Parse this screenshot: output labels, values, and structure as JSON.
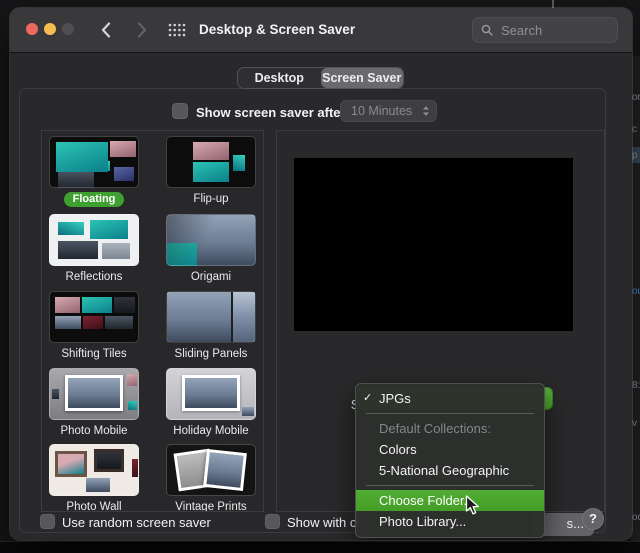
{
  "window": {
    "title": "Desktop & Screen Saver"
  },
  "titlebar": {
    "traffic_lights": [
      "close",
      "minimize",
      "zoom-disabled"
    ],
    "search_placeholder": "Search"
  },
  "tabs": [
    {
      "label": "Desktop",
      "selected": false
    },
    {
      "label": "Screen Saver",
      "selected": true
    }
  ],
  "settings": {
    "show_after_label": "Show screen saver after",
    "show_after_checked": false,
    "delay_value": "10 Minutes",
    "delay_enabled": false
  },
  "savers": {
    "items": [
      {
        "name": "Floating",
        "art": "floating",
        "selected": true
      },
      {
        "name": "Flip-up",
        "art": "flipup",
        "selected": false
      },
      {
        "name": "Reflections",
        "art": "reflections",
        "selected": false
      },
      {
        "name": "Origami",
        "art": "origami",
        "selected": false
      },
      {
        "name": "Shifting Tiles",
        "art": "shifting-tiles",
        "selected": false
      },
      {
        "name": "Sliding Panels",
        "art": "sliding-panels",
        "selected": false
      },
      {
        "name": "Photo Mobile",
        "art": "photo-mobile",
        "selected": false
      },
      {
        "name": "Holiday Mobile",
        "art": "holiday-mobile",
        "selected": false
      },
      {
        "name": "Photo Wall",
        "art": "photo-wall",
        "selected": false
      },
      {
        "name": "Vintage Prints",
        "art": "vintage-prints",
        "selected": false
      }
    ]
  },
  "source": {
    "label": "Source"
  },
  "source_menu": {
    "items": [
      {
        "type": "item",
        "label": "JPGs",
        "checked": true
      },
      {
        "type": "separator"
      },
      {
        "type": "header",
        "label": "Default Collections:"
      },
      {
        "type": "item",
        "label": "Colors"
      },
      {
        "type": "item",
        "label": "5-National Geographic"
      },
      {
        "type": "separator"
      },
      {
        "type": "item",
        "label": "Choose Folder...",
        "highlighted": true
      },
      {
        "type": "item",
        "label": "Photo Library..."
      }
    ]
  },
  "footer": {
    "random_label": "Use random screen saver",
    "random_checked": false,
    "clock_label": "Show with cl",
    "clock_checked": false,
    "hot_corners_visible_label": "s...",
    "help_label": "?"
  },
  "colors": {
    "selected_pill_green": "#3fa032",
    "menu_highlight_green": "#4aa42c",
    "popup_green": "#4fa833",
    "window_bg": "#29292b",
    "titlebar_bg": "#39393b"
  },
  "background_window_fragments": [
    {
      "text": "on",
      "color": "gray"
    },
    {
      "text": "c",
      "color": "gray"
    },
    {
      "text": "p",
      "color": "gray",
      "highlighted": true
    },
    {
      "text": "ou",
      "color": "blue"
    },
    {
      "text": "8:",
      "color": "gray"
    },
    {
      "text": "v",
      "color": "gray"
    },
    {
      "text": "oc",
      "color": "gray"
    }
  ]
}
